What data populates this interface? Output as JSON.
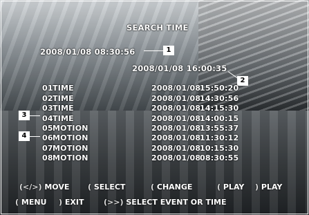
{
  "screen": {
    "title": "SEARCH TIME",
    "search_datetime": "2008/01/08 08:30:56",
    "current_datetime": "2008/01/08 16:00:35",
    "callouts": [
      "1",
      "2",
      "3",
      "4"
    ]
  },
  "events": [
    {
      "index": "01",
      "type": "TIME",
      "date": "2008/01/08",
      "time": "15:50:20"
    },
    {
      "index": "02",
      "type": "TIME",
      "date": "2008/01/08",
      "time": "14:30:56"
    },
    {
      "index": "03",
      "type": "TIME",
      "date": "2008/01/08",
      "time": "14:15:30"
    },
    {
      "index": "04",
      "type": "TIME",
      "date": "2008/01/08",
      "time": "14:00:15"
    },
    {
      "index": "05",
      "type": "MOTION",
      "date": "2008/01/08",
      "time": "13:55:37"
    },
    {
      "index": "06",
      "type": "MOTION",
      "date": "2008/01/08",
      "time": "11:30:12"
    },
    {
      "index": "07",
      "type": "MOTION",
      "date": "2008/01/08",
      "time": "10:15:30"
    },
    {
      "index": "08",
      "type": "MOTION",
      "date": "2008/01/08",
      "time": "08:30:55"
    }
  ],
  "controls": {
    "move_key": "(</>)",
    "move_label": "MOVE",
    "select_key": "(",
    "select_label": "SELECT",
    "change_key": "(",
    "change_label": "CHANGE",
    "play_key": "(",
    "play_label": "PLAY",
    "play2_key": ")",
    "play2_label": "PLAY",
    "menu_key": "(",
    "menu_label": "MENU",
    "exit_key": ")",
    "exit_label": "EXIT",
    "select_event_key": "(>>)",
    "select_event_label": "SELECT EVENT OR TIME"
  }
}
